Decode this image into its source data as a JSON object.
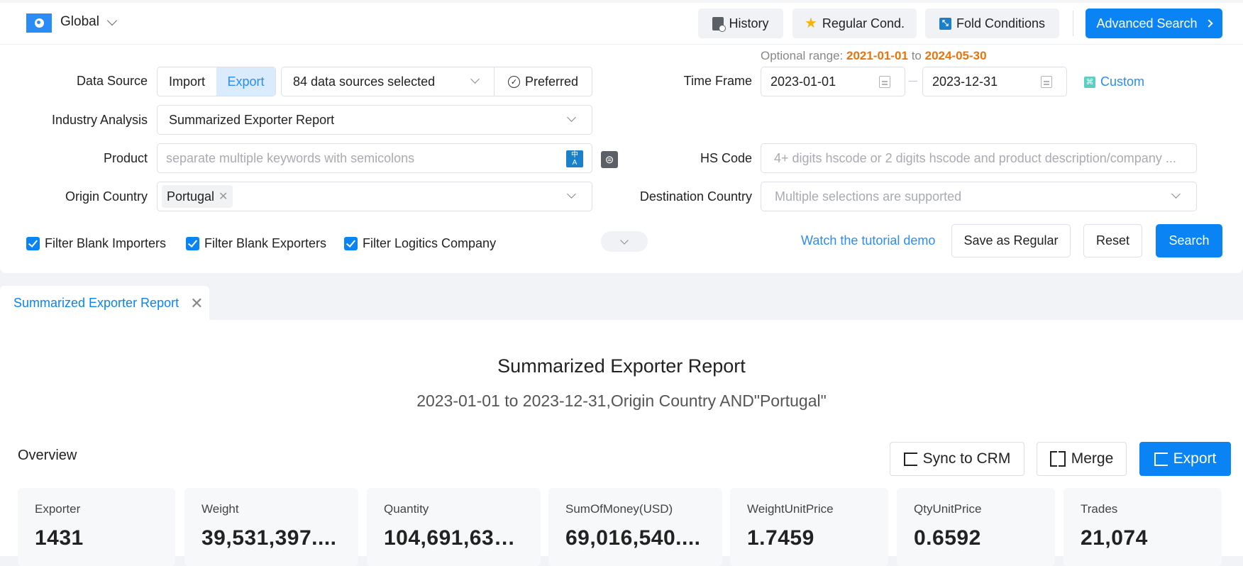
{
  "topbar": {
    "region_label": "Global",
    "region_icon": "globe-icon",
    "buttons": [
      {
        "label": "History",
        "icon": "history-icon"
      },
      {
        "label": "Regular Cond.",
        "icon": "star-icon"
      },
      {
        "label": "Fold Conditions",
        "icon": "fold-icon"
      }
    ],
    "advanced_search_label": "Advanced Search"
  },
  "filters": {
    "data_source": {
      "label": "Data Source",
      "options": [
        "Import",
        "Export"
      ],
      "selected": "Export",
      "sources_value": "84 data sources selected",
      "preferred_label": "Preferred"
    },
    "time_frame": {
      "label": "Time Frame",
      "optional_range_label": "Optional range:",
      "optional_range_start": "2021-01-01",
      "optional_range_to": "to",
      "optional_range_end": "2024-05-30",
      "start_date": "2023-01-01",
      "end_date": "2023-12-31",
      "custom_label": "Custom"
    },
    "industry_analysis": {
      "label": "Industry Analysis",
      "value": "Summarized Exporter Report"
    },
    "product": {
      "label": "Product",
      "placeholder": "separate multiple keywords with semicolons"
    },
    "hs_code": {
      "label": "HS Code",
      "placeholder": "4+ digits hscode or 2 digits hscode and product description/company ..."
    },
    "origin_country": {
      "label": "Origin Country",
      "tags": [
        "Portugal"
      ]
    },
    "destination_country": {
      "label": "Destination Country",
      "placeholder": "Multiple selections are supported"
    },
    "checkboxes": [
      {
        "label": "Filter Blank Importers",
        "checked": true
      },
      {
        "label": "Filter Blank Exporters",
        "checked": true
      },
      {
        "label": "Filter Logitics Company",
        "checked": true
      }
    ],
    "tutorial_link": "Watch the tutorial demo",
    "save_regular_label": "Save as Regular",
    "reset_label": "Reset",
    "search_label": "Search"
  },
  "tabs": [
    {
      "label": "Summarized Exporter Report",
      "active": true
    }
  ],
  "report": {
    "title": "Summarized Exporter Report",
    "subtitle": "2023-01-01 to 2023-12-31,Origin Country AND\"Portugal\"",
    "overview_label": "Overview",
    "sync_crm_label": "Sync to CRM",
    "merge_label": "Merge",
    "export_label": "Export",
    "stats": [
      {
        "label": "Exporter",
        "value": "1431"
      },
      {
        "label": "Weight",
        "value": "39,531,397...."
      },
      {
        "label": "Quantity",
        "value": "104,691,630..."
      },
      {
        "label": "SumOfMoney(USD)",
        "value": "69,016,540...."
      },
      {
        "label": "WeightUnitPrice",
        "value": "1.7459"
      },
      {
        "label": "QtyUnitPrice",
        "value": "0.6592"
      },
      {
        "label": "Trades",
        "value": "21,074"
      }
    ]
  },
  "colors": {
    "primary": "#0a84f5",
    "range_highlight": "#e8740c",
    "link": "#2b8cf7"
  }
}
